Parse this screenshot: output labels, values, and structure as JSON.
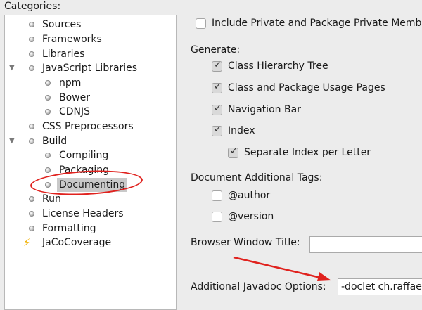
{
  "categories_label": "Categories:",
  "tree": [
    {
      "label": "Sources",
      "icon": "bullet"
    },
    {
      "label": "Frameworks",
      "icon": "bullet"
    },
    {
      "label": "Libraries",
      "icon": "bullet"
    },
    {
      "label": "JavaScript Libraries",
      "icon": "bullet",
      "expanded": true
    },
    {
      "label": "npm",
      "icon": "bullet"
    },
    {
      "label": "Bower",
      "icon": "bullet"
    },
    {
      "label": "CDNJS",
      "icon": "bullet"
    },
    {
      "label": "CSS Preprocessors",
      "icon": "bullet"
    },
    {
      "label": "Build",
      "icon": "bullet",
      "expanded": true
    },
    {
      "label": "Compiling",
      "icon": "bullet"
    },
    {
      "label": "Packaging",
      "icon": "bullet"
    },
    {
      "label": "Documenting",
      "icon": "bullet",
      "selected": true
    },
    {
      "label": "Run",
      "icon": "bullet"
    },
    {
      "label": "License Headers",
      "icon": "bullet"
    },
    {
      "label": "Formatting",
      "icon": "bullet"
    },
    {
      "label": "JaCoCoverage",
      "icon": "lightning-bolt"
    }
  ],
  "include_private": {
    "label": "Include Private and Package Private Memb",
    "checked": false
  },
  "generate": {
    "heading": "Generate:",
    "options": [
      {
        "label": "Class Hierarchy Tree",
        "checked": true
      },
      {
        "label": "Class and Package Usage Pages",
        "checked": true
      },
      {
        "label": "Navigation Bar",
        "checked": true
      },
      {
        "label": "Index",
        "checked": true
      },
      {
        "label": "Separate Index per Letter",
        "checked": true
      }
    ]
  },
  "document_tags": {
    "heading": "Document Additional Tags:",
    "options": [
      {
        "label": "@author",
        "checked": false
      },
      {
        "label": "@version",
        "checked": false
      }
    ]
  },
  "browser_window_title": {
    "label": "Browser Window Title:",
    "value": ""
  },
  "additional_options": {
    "label": "Additional Javadoc Options:",
    "value": "-doclet ch.raffae"
  },
  "colors": {
    "annotation": "#e0221e",
    "selection": "#c9c9c9"
  }
}
